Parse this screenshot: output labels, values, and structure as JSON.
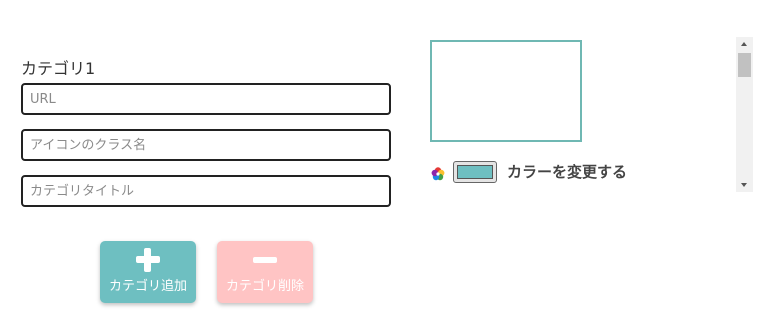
{
  "category": {
    "label": "カテゴリ1",
    "fields": {
      "url_placeholder": "URL",
      "icon_class_placeholder": "アイコンのクラス名",
      "title_placeholder": "カテゴリタイトル"
    }
  },
  "buttons": {
    "add_label": "カテゴリ追加",
    "delete_label": "カテゴリ削除"
  },
  "color": {
    "change_label": "カラーを変更する",
    "swatch": "#6ebfc1",
    "preview_border": "#6fb8b3",
    "icon": "color-wheel-icon"
  },
  "colors": {
    "add_button": "#6ebfc1",
    "delete_button": "#ffc4c4"
  }
}
